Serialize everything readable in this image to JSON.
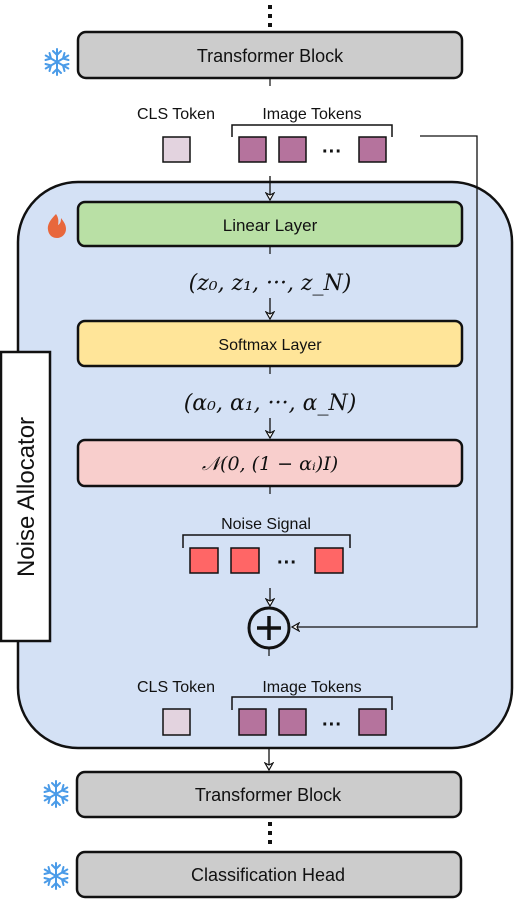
{
  "blocks": {
    "transformer_top": "Transformer Block",
    "linear": "Linear Layer",
    "softmax": "Softmax Layer",
    "gaussian": "𝒩(0, (1 − αᵢ)I)",
    "transformer_bottom": "Transformer Block",
    "classification": "Classification Head"
  },
  "labels": {
    "cls_token_top": "CLS Token",
    "image_tokens_top": "Image Tokens",
    "noise_signal": "Noise Signal",
    "cls_token_bottom": "CLS Token",
    "image_tokens_bottom": "Image Tokens",
    "noise_allocator": "Noise Allocator",
    "ellipsis": "···",
    "z_vector": "(z₀,   z₁,   ···,   z_N)",
    "alpha_vector": "(α₀,   α₁,   ···,   α_N)",
    "plus": "+"
  },
  "icons": {
    "frozen": "snowflake-icon",
    "trainable": "flame-icon"
  },
  "colors": {
    "container": "#d4e1f5",
    "transformer": "#cccccc",
    "linear": "#b9e0a5",
    "softmax": "#ffe599",
    "gaussian": "#f8cecc",
    "cls_token": "#e3d3df",
    "image_token": "#b5739d",
    "noise_token": "#ff6666",
    "snowflake": "#4a9be8",
    "flame": "#e8673c"
  }
}
